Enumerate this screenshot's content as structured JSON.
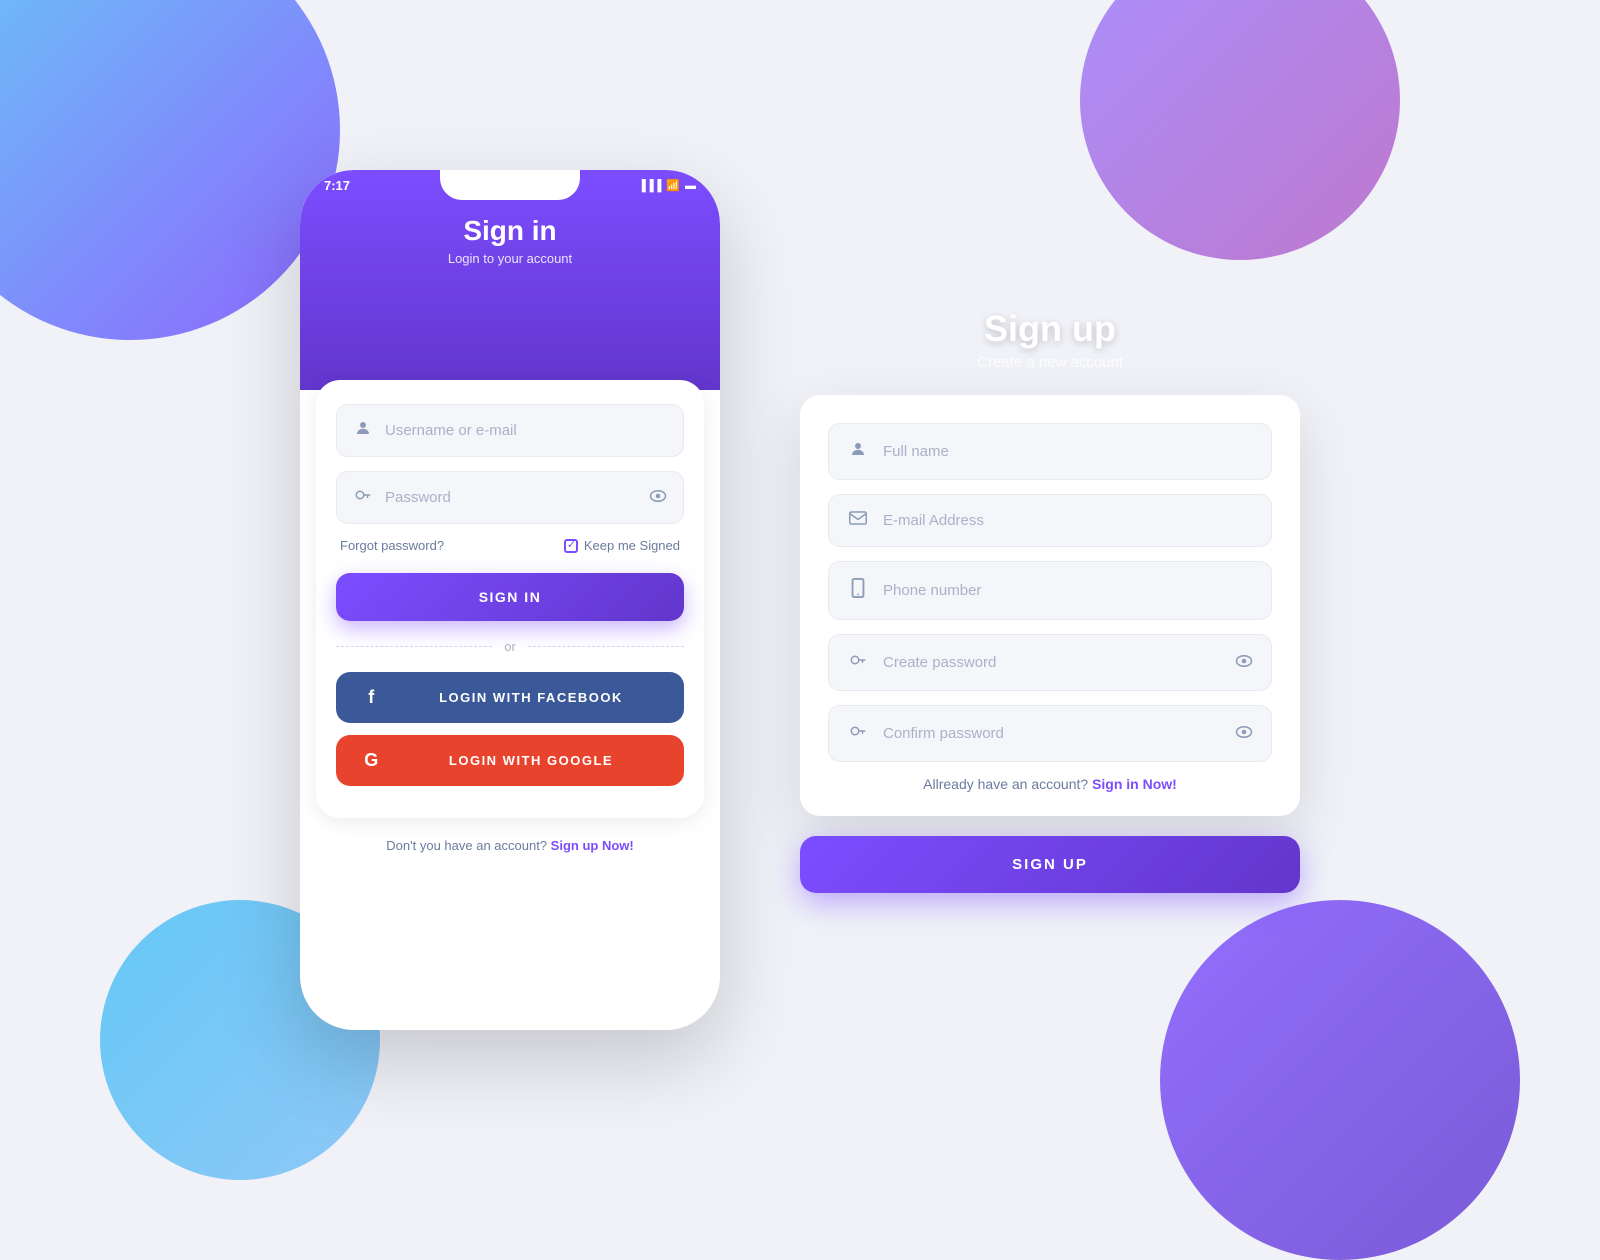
{
  "background": {
    "color": "#f0f2f8"
  },
  "signin": {
    "title": "Sign in",
    "subtitle": "Login to your account",
    "status_time": "7:17",
    "username_placeholder": "Username or e-mail",
    "password_placeholder": "Password",
    "forgot_label": "Forgot password?",
    "keep_signed_label": "Keep me Signed",
    "signin_button": "SIGN IN",
    "divider_label": "or",
    "facebook_button": "LOGIN WITH FACEBOOK",
    "google_button": "LOGIN WITH GOOGLE",
    "footer_text": "Don't you have an account?",
    "footer_link": "Sign up Now!"
  },
  "signup": {
    "title": "Sign up",
    "subtitle": "Create a new account",
    "fullname_placeholder": "Full name",
    "email_placeholder": "E-mail Address",
    "phone_placeholder": "Phone number",
    "create_password_placeholder": "Create password",
    "confirm_password_placeholder": "Confirm password",
    "already_text": "Allready have an account?",
    "already_link": "Sign in Now!",
    "signup_button": "SIGN UP"
  },
  "colors": {
    "purple": "#7c4dff",
    "purple_dark": "#6236cc",
    "facebook": "#3b5998",
    "google": "#e8432d",
    "text_muted": "#aab2c8",
    "text_dark": "#6b7c9e"
  }
}
